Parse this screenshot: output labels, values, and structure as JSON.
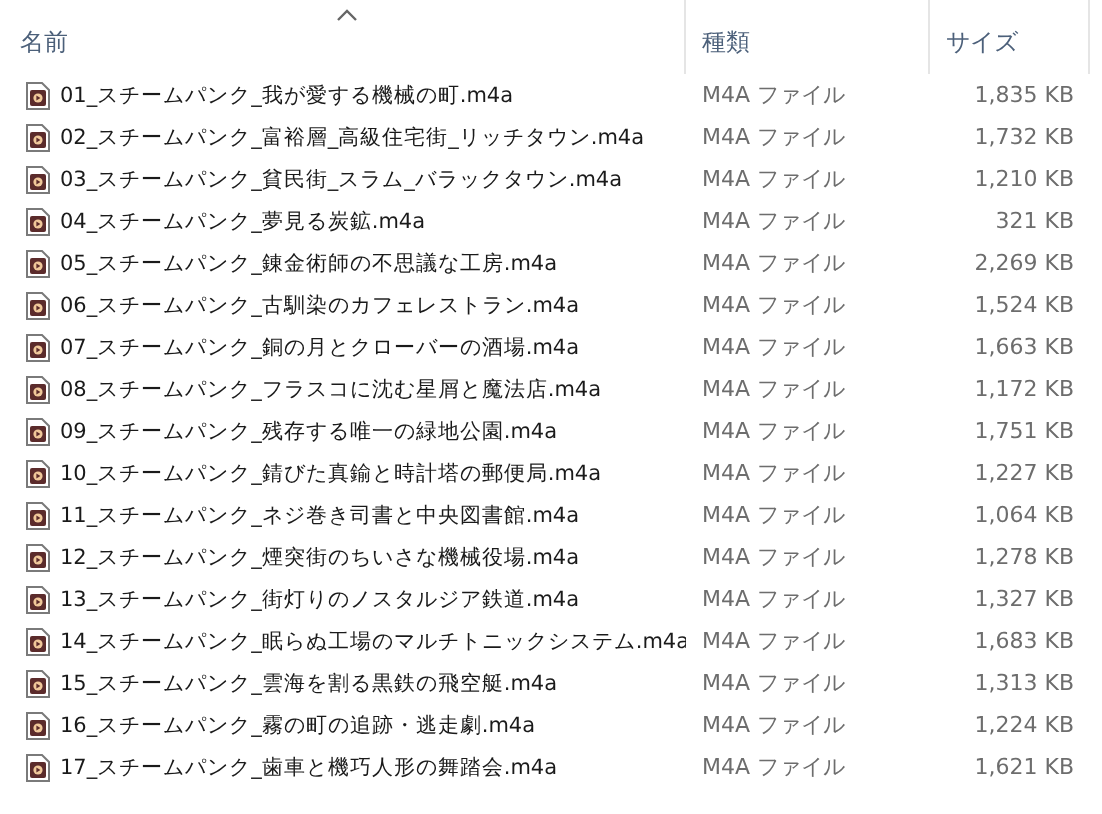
{
  "columns": [
    {
      "label": "名前",
      "sorted": true
    },
    {
      "label": "種類",
      "sorted": false
    },
    {
      "label": "サイズ",
      "sorted": false
    }
  ],
  "files": [
    {
      "name": "01_スチームパンク_我が愛する機械の町.m4a",
      "type": "M4A ファイル",
      "size": "1,835 KB"
    },
    {
      "name": "02_スチームパンク_富裕層_高級住宅街_リッチタウン.m4a",
      "type": "M4A ファイル",
      "size": "1,732 KB"
    },
    {
      "name": "03_スチームパンク_貧民街_スラム_バラックタウン.m4a",
      "type": "M4A ファイル",
      "size": "1,210 KB"
    },
    {
      "name": "04_スチームパンク_夢見る炭鉱.m4a",
      "type": "M4A ファイル",
      "size": "321 KB"
    },
    {
      "name": "05_スチームパンク_錬金術師の不思議な工房.m4a",
      "type": "M4A ファイル",
      "size": "2,269 KB"
    },
    {
      "name": "06_スチームパンク_古馴染のカフェレストラン.m4a",
      "type": "M4A ファイル",
      "size": "1,524 KB"
    },
    {
      "name": "07_スチームパンク_銅の月とクローバーの酒場.m4a",
      "type": "M4A ファイル",
      "size": "1,663 KB"
    },
    {
      "name": "08_スチームパンク_フラスコに沈む星屑と魔法店.m4a",
      "type": "M4A ファイル",
      "size": "1,172 KB"
    },
    {
      "name": "09_スチームパンク_残存する唯一の緑地公園.m4a",
      "type": "M4A ファイル",
      "size": "1,751 KB"
    },
    {
      "name": "10_スチームパンク_錆びた真鍮と時計塔の郵便局.m4a",
      "type": "M4A ファイル",
      "size": "1,227 KB"
    },
    {
      "name": "11_スチームパンク_ネジ巻き司書と中央図書館.m4a",
      "type": "M4A ファイル",
      "size": "1,064 KB"
    },
    {
      "name": "12_スチームパンク_煙突街のちいさな機械役場.m4a",
      "type": "M4A ファイル",
      "size": "1,278 KB"
    },
    {
      "name": "13_スチームパンク_街灯りのノスタルジア鉄道.m4a",
      "type": "M4A ファイル",
      "size": "1,327 KB"
    },
    {
      "name": "14_スチームパンク_眠らぬ工場のマルチトニックシステム.m4a",
      "type": "M4A ファイル",
      "size": "1,683 KB"
    },
    {
      "name": "15_スチームパンク_雲海を割る黒鉄の飛空艇.m4a",
      "type": "M4A ファイル",
      "size": "1,313 KB"
    },
    {
      "name": "16_スチームパンク_霧の町の追跡・逃走劇.m4a",
      "type": "M4A ファイル",
      "size": "1,224 KB"
    },
    {
      "name": "17_スチームパンク_歯車と機巧人形の舞踏会.m4a",
      "type": "M4A ファイル",
      "size": "1,621 KB"
    }
  ]
}
